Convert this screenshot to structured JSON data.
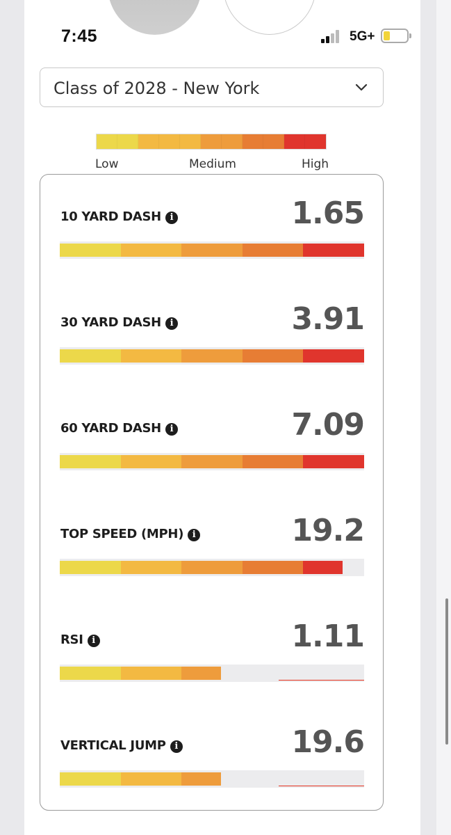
{
  "status_bar": {
    "time": "7:45",
    "network": "5G+"
  },
  "class_selector": {
    "value": "Class of 2028 - New York"
  },
  "legend": {
    "low": "Low",
    "medium": "Medium",
    "high": "High",
    "colors": [
      "#ecd84a",
      "#f3b942",
      "#ee9c3c",
      "#e77d34",
      "#e0352d"
    ]
  },
  "metrics": [
    {
      "label": "10 YARD DASH",
      "value": "1.65",
      "level": 1.0
    },
    {
      "label": "30 YARD DASH",
      "value": "3.91",
      "level": 1.0
    },
    {
      "label": "60 YARD DASH",
      "value": "7.09",
      "level": 1.0
    },
    {
      "label": "TOP SPEED (MPH)",
      "value": "19.2",
      "level": 0.93
    },
    {
      "label": "RSI",
      "value": "1.11",
      "level": 0.53
    },
    {
      "label": "VERTICAL JUMP",
      "value": "19.6",
      "level": 0.53
    }
  ]
}
